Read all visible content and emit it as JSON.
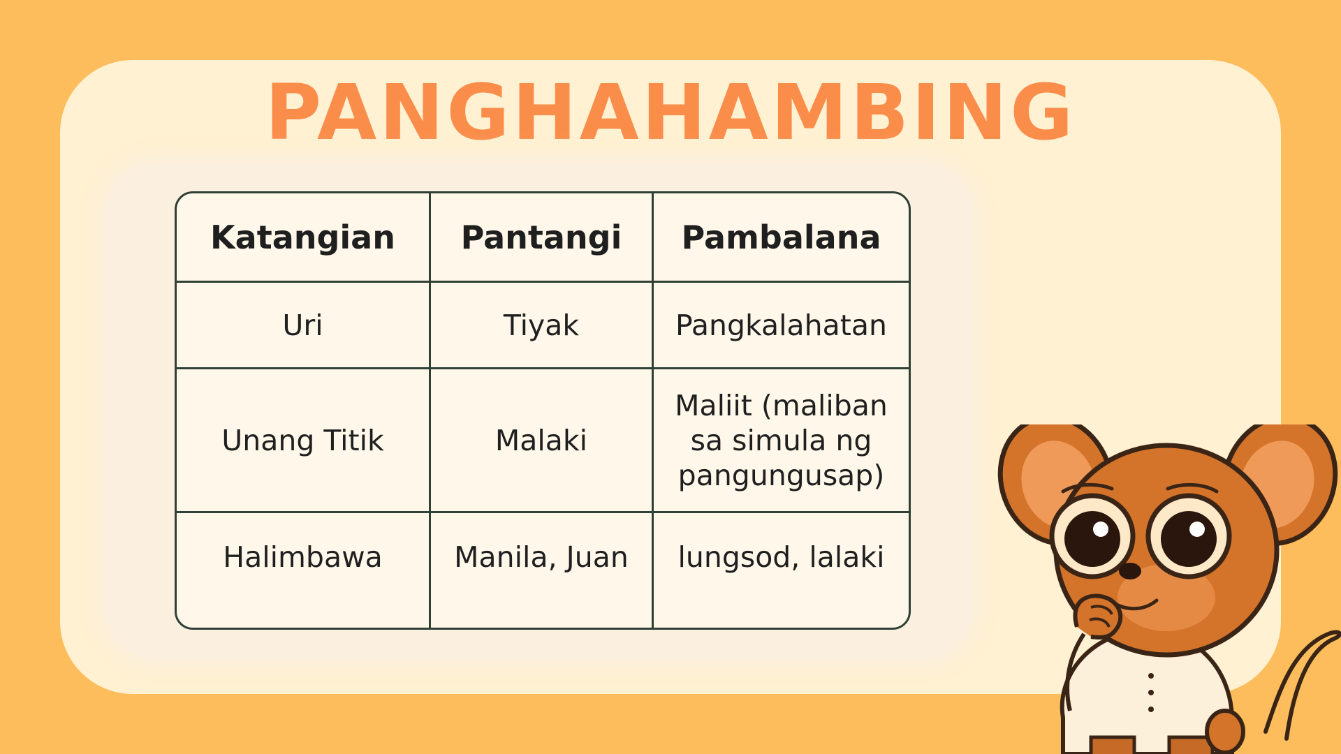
{
  "slide": {
    "title": "PANGHAHAMBING"
  },
  "table": {
    "headers": [
      "Katangian",
      "Pantangi",
      "Pambalana"
    ],
    "rows": [
      [
        "Uri",
        "Tiyak",
        "Pangkalahatan"
      ],
      [
        "Unang Titik",
        "Malaki",
        "Maliit (maliban sa simula ng pangungusap)"
      ],
      [
        "Halimbawa",
        "Manila, Juan",
        "lungsod, lalaki"
      ]
    ]
  },
  "colors": {
    "background": "#fdbd5c",
    "card": "#fff1d2",
    "title": "#fb8d4b",
    "table_border": "#2f3f34",
    "mascot_fur": "#d4742a"
  },
  "mascot": {
    "icon": "tarsier-mascot-icon"
  }
}
